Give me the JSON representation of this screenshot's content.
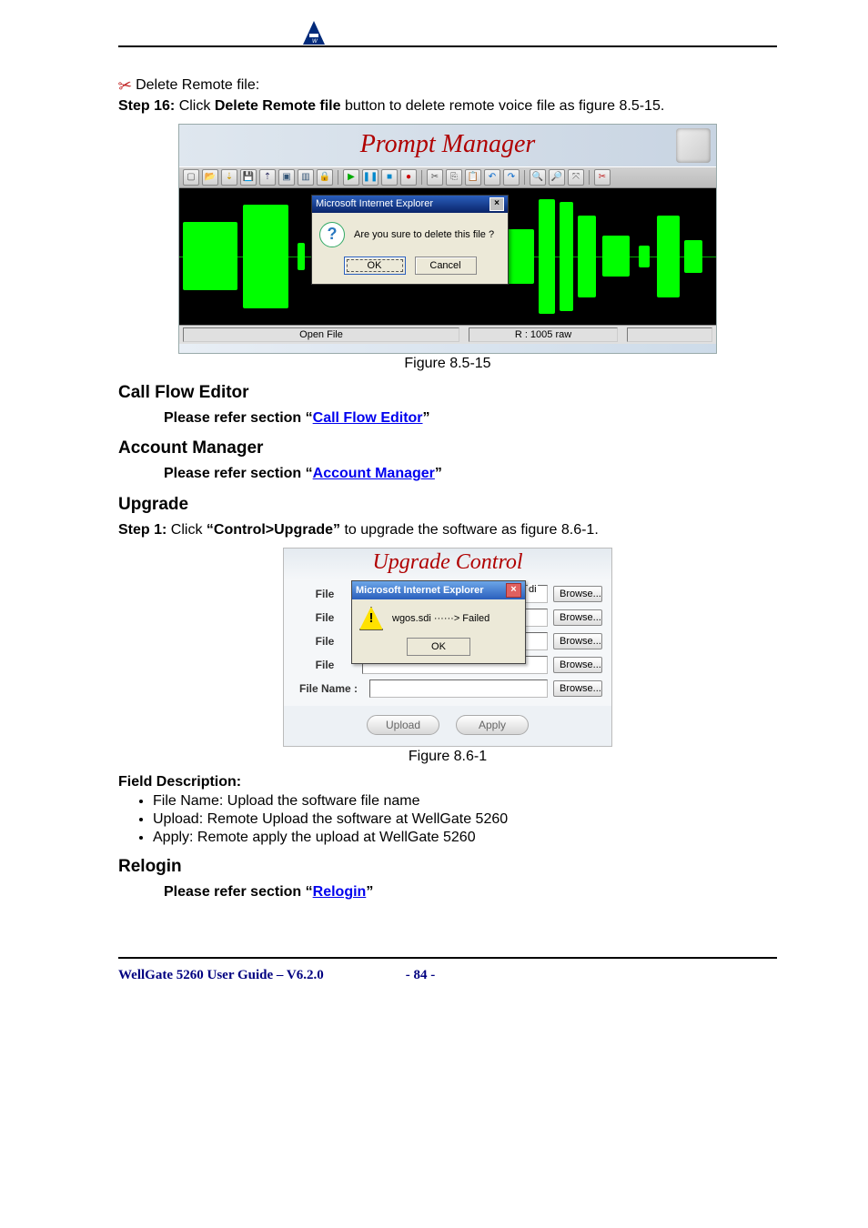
{
  "top_icon": "welltech-logo",
  "scissors_icon": "✂",
  "delete_remote_label": "Delete Remote file:",
  "step16_prefix": "Step 16:",
  "step16_text_a": " Click ",
  "step16_bold": "Delete Remote file",
  "step16_text_b": " button to delete remote voice file as figure 8.5-15.",
  "fig85": {
    "title": "Prompt Manager",
    "toolbar_icons": [
      "new",
      "open",
      "download",
      "save",
      "saveas",
      "import",
      "copywin",
      "copysel",
      "lock",
      "play",
      "pause",
      "stop",
      "record",
      "cut",
      "copy",
      "paste",
      "undo",
      "redo",
      "zoomin",
      "zoomout",
      "zoomfit",
      "delete-remote"
    ],
    "dialog": {
      "title": "Microsoft Internet Explorer",
      "message": "Are you sure to delete this file ?",
      "ok": "OK",
      "cancel": "Cancel"
    },
    "status_left": "Open File",
    "status_right": "R : 1005 raw",
    "caption": "Figure 8.5-15"
  },
  "sections": {
    "call_flow": {
      "heading": "Call Flow Editor",
      "line_a": "Please refer section “",
      "link": "Call Flow Editor",
      "line_b": "”"
    },
    "account_mgr": {
      "heading": "Account Manager",
      "line_a": "Please refer section “",
      "link": "Account Manager",
      "line_b": "”"
    },
    "upgrade": {
      "heading": "Upgrade",
      "step1_prefix": "Step 1:",
      "step1_a": " Click ",
      "step1_bold": "“Control>Upgrade”",
      "step1_b": " to upgrade the software as figure 8.6-1."
    },
    "relogin": {
      "heading": "Relogin",
      "line_a": "Please refer section “",
      "link": "Relogin",
      "line_b": "”"
    }
  },
  "fig86": {
    "title": "Upgrade Control",
    "rows": [
      {
        "label": "File",
        "browse": "Browse..."
      },
      {
        "label": "File",
        "browse": "Browse..."
      },
      {
        "label": "File",
        "browse": "Browse..."
      },
      {
        "label": "File",
        "browse": "Browse..."
      },
      {
        "label": "File Name :",
        "browse": "Browse..."
      }
    ],
    "dialog": {
      "title": "Microsoft Internet Explorer",
      "message": "wgos.sdi ······> Failed",
      "ok": "OK",
      "trailing": "di"
    },
    "upload": "Upload",
    "apply": "Apply",
    "caption": "Figure 8.6-1"
  },
  "field_desc": {
    "heading": "Field Description:",
    "items": [
      "File Name: Upload the software file name",
      "Upload: Remote Upload the software at WellGate 5260",
      "Apply: Remote apply the upload at WellGate 5260"
    ]
  },
  "footer": {
    "left": "WellGate 5260 User Guide – V6.2.0",
    "right": "- 84 -"
  }
}
